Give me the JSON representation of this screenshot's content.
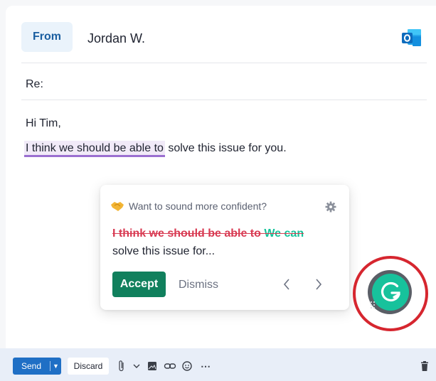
{
  "header": {
    "from_label": "From",
    "from_name": "Jordan W.",
    "subject": "Re:"
  },
  "body": {
    "greeting": "Hi Tim,",
    "highlighted": "I think we should be able to",
    "rest": " solve this issue for you."
  },
  "suggestion": {
    "prompt": "Want to sound more confident?",
    "struck": "I think we should be able to",
    "replacement": "We can",
    "continuation": "solve this issue for...",
    "accept_label": "Accept",
    "dismiss_label": "Dismiss"
  },
  "toolbar": {
    "send_label": "Send",
    "discard_label": "Discard",
    "more_label": "⋯"
  },
  "colors": {
    "grammarly_green": "#15c39a",
    "accept_green": "#11805d",
    "strike_red": "#d83a52",
    "highlight_purple": "#9b6fd0",
    "send_blue": "#1f6fc5",
    "ring_red": "#d6262f"
  },
  "icons": [
    "outlook-icon",
    "handshake-icon",
    "gear-icon",
    "chevron-left-icon",
    "chevron-right-icon",
    "grammarly-icon",
    "attach-icon",
    "chevron-down-icon",
    "image-icon",
    "link-icon",
    "emoji-icon",
    "more-icon",
    "trash-icon"
  ]
}
